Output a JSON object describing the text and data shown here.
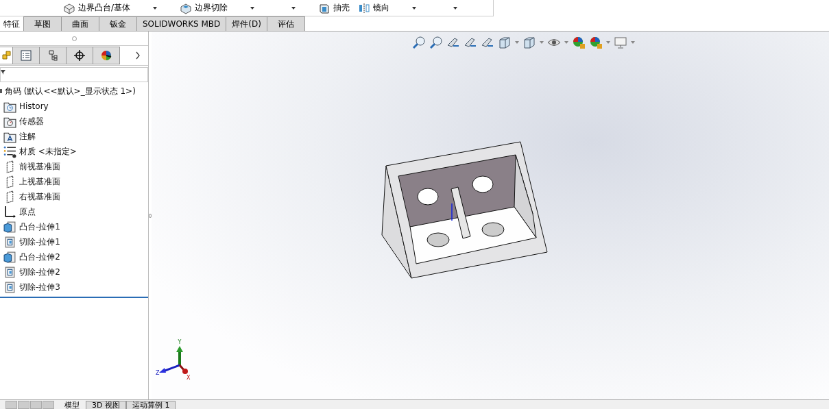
{
  "toolbar": {
    "items": [
      {
        "kind": "command",
        "label": "边界凸台/基体"
      },
      {
        "kind": "caret"
      },
      {
        "kind": "command",
        "label": "边界切除"
      },
      {
        "kind": "caret"
      },
      {
        "kind": "caret"
      },
      {
        "kind": "command",
        "label": "抽壳"
      },
      {
        "kind": "command",
        "label": "镜向"
      },
      {
        "kind": "caret"
      },
      {
        "kind": "caret"
      }
    ]
  },
  "tabs": [
    {
      "label": "特征",
      "selected": true
    },
    {
      "label": "草图",
      "selected": false
    },
    {
      "label": "曲面",
      "selected": false
    },
    {
      "label": "钣金",
      "selected": false
    },
    {
      "label": "SOLIDWORKS MBD",
      "selected": false
    },
    {
      "label": "焊件(D)",
      "selected": false
    },
    {
      "label": "评估",
      "selected": false
    }
  ],
  "panel_tabs": [
    {
      "selected": true
    },
    {
      "selected": false
    },
    {
      "selected": false
    },
    {
      "selected": false
    },
    {
      "selected": false
    }
  ],
  "tree": {
    "label": "角码  (默认<<默认>_显示状态 1>)",
    "children": [
      {
        "kind": "history",
        "label": "History"
      },
      {
        "kind": "sensor",
        "label": "传感器"
      },
      {
        "kind": "annotation",
        "label": "注解"
      },
      {
        "kind": "material",
        "label": "材质 <未指定>"
      },
      {
        "kind": "plane",
        "label": "前视基准面"
      },
      {
        "kind": "plane",
        "label": "上视基准面"
      },
      {
        "kind": "plane",
        "label": "右视基准面"
      },
      {
        "kind": "origin",
        "label": "原点"
      },
      {
        "kind": "boss",
        "label": "凸台-拉伸1"
      },
      {
        "kind": "cut",
        "label": "切除-拉伸1"
      },
      {
        "kind": "boss",
        "label": "凸台-拉伸2"
      },
      {
        "kind": "cut",
        "label": "切除-拉伸2"
      },
      {
        "kind": "cut",
        "label": "切除-拉伸3"
      }
    ]
  },
  "triad": {
    "x": "X",
    "y": "Y",
    "z": "Z"
  },
  "bottom_tabs": [
    {
      "label": "模型",
      "selected": true
    },
    {
      "label": "3D 视图",
      "selected": false
    },
    {
      "label": "运动算例 1",
      "selected": false
    }
  ]
}
